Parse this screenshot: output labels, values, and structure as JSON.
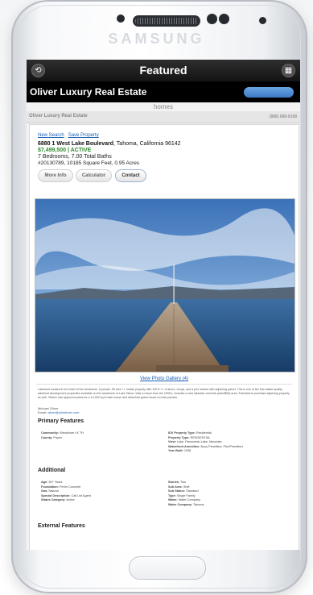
{
  "device": {
    "brand": "SAMSUNG"
  },
  "app_bar": {
    "title": "Featured",
    "back_icon": "refresh-icon",
    "grid_icon": "grid-icon"
  },
  "brand_bar": {
    "name": "Oliver Luxury Real Estate"
  },
  "page": {
    "section_label": "homes",
    "agent_name": "Oliver Luxury Real Estate",
    "phone": "(888) 888-8188"
  },
  "listing": {
    "links": {
      "new_search": "New Search",
      "save_property": "Save Property"
    },
    "address_street": "6880 1 West Lake Boulevard",
    "address_rest": ", Tahoma, California 96142",
    "price_status": "$7,499,500 | ACTIVE",
    "beds_baths": "7 Bedrooms, 7.00 Total Baths",
    "mls_sqft": "#20130789, 10185 Square Feet, 0.95 Acres",
    "buttons": {
      "more_info": "More Info",
      "calculator": "Calculator",
      "contact": "Contact"
    },
    "gallery_link": "View Photo Gallery (4)",
    "description": "Lakefront located in the heart of the westshore. A private .95 acre +/- estate property with 100 ft +/- of shore, buoys, and a pier shared with adjoining parcel. This is one of the few estate quality lakefront development properties available on the westshore of Lake Tahoe. Was a resort from the 1900's, includes a new lakeside concrete patio/BBQ area. Potential to purchase adjoining property as well. Sellers had approved plans for a 14,000 sq ft main house and detached guest house on both parcels.",
    "contact_name": "Michael Oliver",
    "contact_email_label": "Email:",
    "contact_email": "oliver@oliverluxe.com"
  },
  "primary_features": {
    "heading": "Primary Features",
    "left": [
      {
        "label": "Community:",
        "value": "Westshore LK TH"
      },
      {
        "label": "County:",
        "value": "Placer"
      }
    ],
    "right": [
      {
        "label": "IDX Property Type:",
        "value": "Residential"
      },
      {
        "label": "Property Type:",
        "value": "RESIDENTIAL"
      },
      {
        "label": "View:",
        "value": "Lake, Panoramic-Lake, Mountain"
      },
      {
        "label": "Waterfront Amenities:",
        "value": "Buoy Permitted, Pier/Permitted"
      },
      {
        "label": "Year Built:",
        "value": "1938"
      }
    ]
  },
  "additional": {
    "heading": "Additional",
    "left": [
      {
        "label": "Age:",
        "value": "50+ Years"
      },
      {
        "label": "Foundation:",
        "value": "Perim Concrete"
      },
      {
        "label": "Gas:",
        "value": "Natural"
      },
      {
        "label": "Special Description:",
        "value": "Call List Agent"
      },
      {
        "label": "Status Category:",
        "value": "Active"
      }
    ],
    "right": [
      {
        "label": "Stories:",
        "value": "Two"
      },
      {
        "label": "Sub Area:",
        "value": "Shift"
      },
      {
        "label": "Sub Status:",
        "value": "Standard"
      },
      {
        "label": "Type:",
        "value": "Single Family"
      },
      {
        "label": "Water:",
        "value": "Water Company"
      },
      {
        "label": "Water Company:",
        "value": "Tahoma"
      }
    ]
  },
  "external_features": {
    "heading": "External Features"
  }
}
